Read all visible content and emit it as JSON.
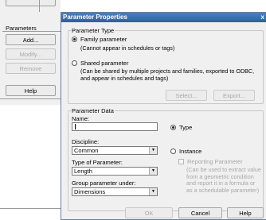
{
  "background_panel": {
    "top_button_label": "",
    "section_label": "Parameters",
    "add_label": "Add...",
    "modify_label": "Modify...",
    "remove_label": "Remove",
    "help_label": "Help"
  },
  "dialog": {
    "title": "Parameter Properties",
    "close_glyph": "x",
    "parameter_type": {
      "legend": "Parameter Type",
      "family_label": "Family parameter",
      "family_note": "(Cannot appear in schedules or tags)",
      "shared_label": "Shared parameter",
      "shared_note": "(Can be shared by multiple projects and families, exported to ODBC, and appear in schedules and tags)",
      "selected": "family",
      "select_label": "Select...",
      "export_label": "Export..."
    },
    "parameter_data": {
      "legend": "Parameter Data",
      "name_label": "Name:",
      "name_value": "",
      "discipline_label": "Discipline:",
      "discipline_value": "Common",
      "type_of_parameter_label": "Type of Parameter:",
      "type_of_parameter_value": "Length",
      "group_label": "Group parameter under:",
      "group_value": "Dimensions",
      "type_label": "Type",
      "instance_label": "Instance",
      "selected": "type",
      "reporting_label": "Reporting Parameter",
      "reporting_note": "(Can be used to extract value from a geometric condition and report it in a formula or as a schedulable parameter)"
    },
    "footer": {
      "ok_label": "OK",
      "cancel_label": "Cancel",
      "help_label": "Help"
    }
  }
}
